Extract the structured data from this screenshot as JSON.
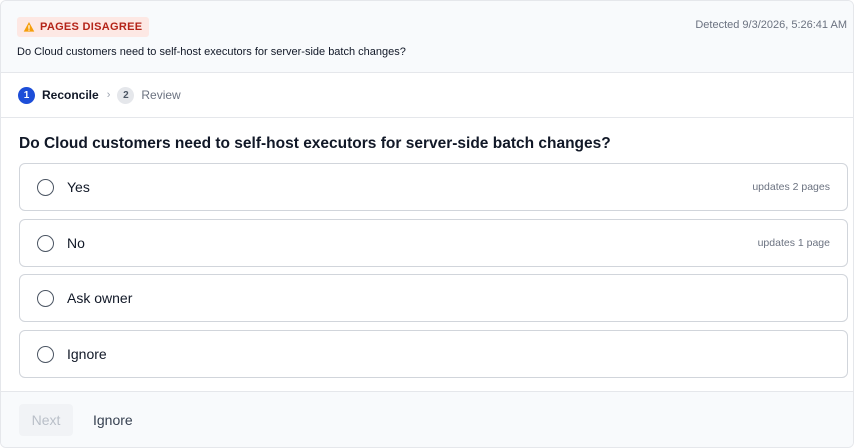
{
  "header": {
    "badge": "PAGES DISAGREE",
    "detected": "Detected 9/3/2026, 5:26:41 AM",
    "question": "Do Cloud customers need to self-host executors for server-side batch changes?"
  },
  "steps": [
    {
      "number": "1",
      "label": "Reconcile"
    },
    {
      "number": "2",
      "label": "Review"
    }
  ],
  "question_title": "Do Cloud customers need to self-host executors for server-side batch changes?",
  "options": [
    {
      "label": "Yes",
      "meta": "updates 2 pages"
    },
    {
      "label": "No",
      "meta": "updates 1 page"
    },
    {
      "label": "Ask owner",
      "meta": ""
    },
    {
      "label": "Ignore",
      "meta": ""
    }
  ],
  "footer": {
    "next_label": "Next",
    "ignore_label": "Ignore"
  },
  "colors": {
    "accent": "#1d4ed8",
    "warning_bg": "#fde8e4",
    "warning_text": "#b42318",
    "warning_icon": "#f59e0b"
  },
  "icons": {
    "badge": "warning-triangle-icon",
    "step_separator": "chevron-right-icon"
  }
}
